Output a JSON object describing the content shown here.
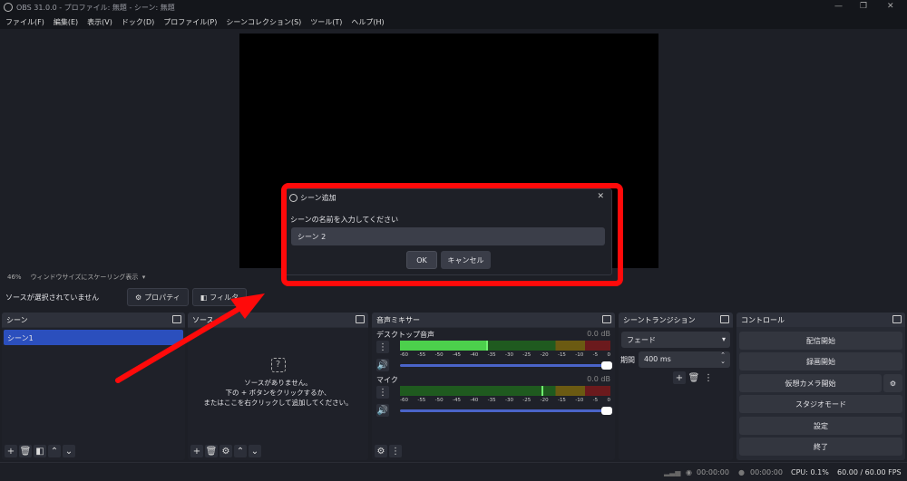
{
  "window": {
    "title": "OBS 31.0.0 - プロファイル: 無題 - シーン: 無題"
  },
  "menu": [
    "ファイル(F)",
    "編集(E)",
    "表示(V)",
    "ドック(D)",
    "プロファイル(P)",
    "シーンコレクション(S)",
    "ツール(T)",
    "ヘルプ(H)"
  ],
  "zoombar": {
    "zoom": "46%",
    "mode": "ウィンドウサイズにスケーリング表示"
  },
  "source_toolbar": {
    "status": "ソースが選択されていません",
    "properties": "プロパティ",
    "filters": "フィルタ"
  },
  "scenes": {
    "title": "シーン",
    "items": [
      "シーン1"
    ]
  },
  "sources": {
    "title": "ソース",
    "empty_line1": "ソースがありません。",
    "empty_line2": "下の + ボタンをクリックするか、",
    "empty_line3": "またはここを右クリックして追加してください。"
  },
  "mixer": {
    "title": "音声ミキサー",
    "scale": [
      "-60",
      "-55",
      "-50",
      "-45",
      "-40",
      "-35",
      "-30",
      "-25",
      "-20",
      "-15",
      "-10",
      "-5",
      "0"
    ],
    "channels": [
      {
        "name": "デスクトップ音声",
        "db": "0.0 dB",
        "level": 0.42,
        "volume": 1.0
      },
      {
        "name": "マイク",
        "db": "0.0 dB",
        "level": 0.68,
        "volume": 1.0
      }
    ]
  },
  "transitions": {
    "title": "シーントランジション",
    "selected": "フェード",
    "duration_label": "期間",
    "duration": "400 ms"
  },
  "controls": {
    "title": "コントロール",
    "buttons": [
      "配信開始",
      "録画開始",
      "仮想カメラ開始",
      "スタジオモード",
      "設定",
      "終了"
    ]
  },
  "status": {
    "stream_time": "00:00:00",
    "rec_time": "00:00:00",
    "cpu": "CPU: 0.1%",
    "fps": "60.00 / 60.00 FPS"
  },
  "dialog": {
    "title": "シーン追加",
    "prompt": "シーンの名前を入力してください",
    "value": "シーン 2",
    "ok": "OK",
    "cancel": "キャンセル",
    "close": "✕"
  },
  "colors": {
    "annotation": "#ff0a0a",
    "selected": "#2b4fbd"
  }
}
